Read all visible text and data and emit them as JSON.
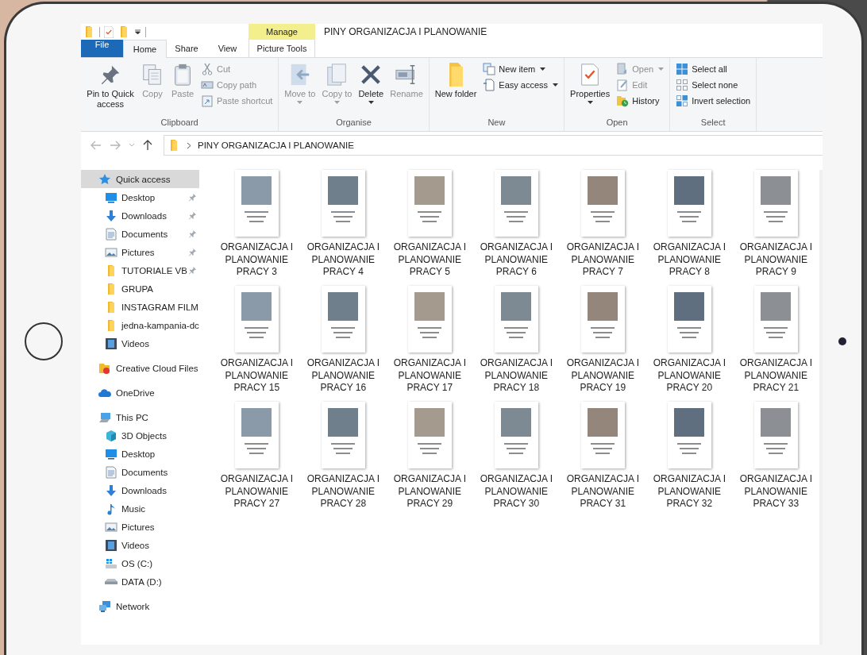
{
  "window": {
    "title": "PINY ORGANIZACJA I PLANOWANIE"
  },
  "context_tab_group": {
    "label": "Manage"
  },
  "tabs": [
    {
      "label": "File",
      "kind": "file",
      "selected": false
    },
    {
      "label": "Home",
      "kind": "tab",
      "selected": true
    },
    {
      "label": "Share",
      "kind": "tab",
      "selected": false
    },
    {
      "label": "View",
      "kind": "tab",
      "selected": false
    },
    {
      "label": "Picture Tools",
      "kind": "context",
      "selected": false
    }
  ],
  "ribbon": {
    "groups": [
      {
        "label": "Clipboard",
        "items": [
          {
            "kind": "large",
            "label": "Pin to Quick access",
            "disabled": false,
            "dropdown": false
          },
          {
            "kind": "large",
            "label": "Copy",
            "disabled": true,
            "dropdown": false
          },
          {
            "kind": "large",
            "label": "Paste",
            "disabled": true,
            "dropdown": false
          },
          {
            "kind": "stack",
            "items": [
              {
                "label": "Cut",
                "disabled": true,
                "dropdown": false
              },
              {
                "label": "Copy path",
                "disabled": true,
                "dropdown": false
              },
              {
                "label": "Paste shortcut",
                "disabled": true,
                "dropdown": false
              }
            ]
          }
        ]
      },
      {
        "label": "Organise",
        "items": [
          {
            "kind": "large",
            "label": "Move to",
            "disabled": true,
            "dropdown": true
          },
          {
            "kind": "large",
            "label": "Copy to",
            "disabled": true,
            "dropdown": true
          },
          {
            "kind": "large",
            "label": "Delete",
            "disabled": false,
            "dropdown": true
          },
          {
            "kind": "large",
            "label": "Rename",
            "disabled": true,
            "dropdown": false
          }
        ]
      },
      {
        "label": "New",
        "items": [
          {
            "kind": "large",
            "label": "New folder",
            "disabled": false,
            "dropdown": false
          },
          {
            "kind": "stack",
            "items": [
              {
                "label": "New item",
                "disabled": false,
                "dropdown": true
              },
              {
                "label": "Easy access",
                "disabled": false,
                "dropdown": true
              }
            ]
          }
        ]
      },
      {
        "label": "Open",
        "items": [
          {
            "kind": "large",
            "label": "Properties",
            "disabled": false,
            "dropdown": true
          },
          {
            "kind": "stack",
            "items": [
              {
                "label": "Open",
                "disabled": true,
                "dropdown": true
              },
              {
                "label": "Edit",
                "disabled": true,
                "dropdown": false
              },
              {
                "label": "History",
                "disabled": false,
                "dropdown": false
              }
            ]
          }
        ]
      },
      {
        "label": "Select",
        "items": [
          {
            "kind": "stack",
            "items": [
              {
                "label": "Select all",
                "disabled": false,
                "dropdown": false
              },
              {
                "label": "Select none",
                "disabled": false,
                "dropdown": false
              },
              {
                "label": "Invert selection",
                "disabled": false,
                "dropdown": false
              }
            ]
          }
        ]
      }
    ]
  },
  "address_bar": {
    "path": "PINY ORGANIZACJA I PLANOWANIE"
  },
  "sidebar": {
    "items": [
      {
        "label": "Quick access",
        "kind": "star",
        "selected": true,
        "children": [
          {
            "label": "Desktop",
            "kind": "desktop",
            "selected": false,
            "pinned": true
          },
          {
            "label": "Downloads",
            "kind": "downloads",
            "selected": false,
            "pinned": true
          },
          {
            "label": "Documents",
            "kind": "documents",
            "selected": false,
            "pinned": true
          },
          {
            "label": "Pictures",
            "kind": "pictures",
            "selected": false,
            "pinned": true
          },
          {
            "label": "TUTORIALE VB",
            "kind": "folder",
            "selected": false,
            "pinned": true
          },
          {
            "label": "GRUPA",
            "kind": "folder",
            "selected": false,
            "pinned": false
          },
          {
            "label": "INSTAGRAM FILM",
            "kind": "folder",
            "selected": false,
            "pinned": false
          },
          {
            "label": "jedna-kampania-dc",
            "kind": "folder",
            "selected": false,
            "pinned": false
          },
          {
            "label": "Videos",
            "kind": "videos",
            "selected": false,
            "pinned": false
          }
        ]
      },
      {
        "label": "Creative Cloud Files",
        "kind": "cloudfiles",
        "selected": false
      },
      {
        "label": "OneDrive",
        "kind": "onedrive",
        "selected": false
      },
      {
        "label": "This PC",
        "kind": "pc",
        "selected": false,
        "children": [
          {
            "label": "3D Objects",
            "kind": "objects",
            "selected": false
          },
          {
            "label": "Desktop",
            "kind": "desktop",
            "selected": false
          },
          {
            "label": "Documents",
            "kind": "documents",
            "selected": false
          },
          {
            "label": "Downloads",
            "kind": "downloads",
            "selected": false
          },
          {
            "label": "Music",
            "kind": "music",
            "selected": false
          },
          {
            "label": "Pictures",
            "kind": "pictures",
            "selected": false
          },
          {
            "label": "Videos",
            "kind": "videos",
            "selected": false
          },
          {
            "label": "OS (C:)",
            "kind": "osdrive",
            "selected": false
          },
          {
            "label": "DATA (D:)",
            "kind": "drive",
            "selected": false
          }
        ]
      },
      {
        "label": "Network",
        "kind": "network",
        "selected": false
      }
    ]
  },
  "files": [
    {
      "name": "ORGANIZACJA I PLANOWANIE PRACY 3"
    },
    {
      "name": "ORGANIZACJA I PLANOWANIE PRACY 4"
    },
    {
      "name": "ORGANIZACJA I PLANOWANIE PRACY 5"
    },
    {
      "name": "ORGANIZACJA I PLANOWANIE PRACY 6"
    },
    {
      "name": "ORGANIZACJA I PLANOWANIE PRACY 7"
    },
    {
      "name": "ORGANIZACJA I PLANOWANIE PRACY 8"
    },
    {
      "name": "ORGANIZACJA I PLANOWANIE PRACY 9"
    },
    {
      "name": "ORGANIZACJA I PLANOWANIE PRACY 15"
    },
    {
      "name": "ORGANIZACJA I PLANOWANIE PRACY 16"
    },
    {
      "name": "ORGANIZACJA I PLANOWANIE PRACY 17"
    },
    {
      "name": "ORGANIZACJA I PLANOWANIE PRACY 18"
    },
    {
      "name": "ORGANIZACJA I PLANOWANIE PRACY 19"
    },
    {
      "name": "ORGANIZACJA I PLANOWANIE PRACY 20"
    },
    {
      "name": "ORGANIZACJA I PLANOWANIE PRACY 21"
    },
    {
      "name": "ORGANIZACJA I PLANOWANIE PRACY 27"
    },
    {
      "name": "ORGANIZACJA I PLANOWANIE PRACY 28"
    },
    {
      "name": "ORGANIZACJA I PLANOWANIE PRACY 29"
    },
    {
      "name": "ORGANIZACJA I PLANOWANIE PRACY 30"
    },
    {
      "name": "ORGANIZACJA I PLANOWANIE PRACY 31"
    },
    {
      "name": "ORGANIZACJA I PLANOWANIE PRACY 32"
    },
    {
      "name": "ORGANIZACJA I PLANOWANIE PRACY 33"
    }
  ]
}
